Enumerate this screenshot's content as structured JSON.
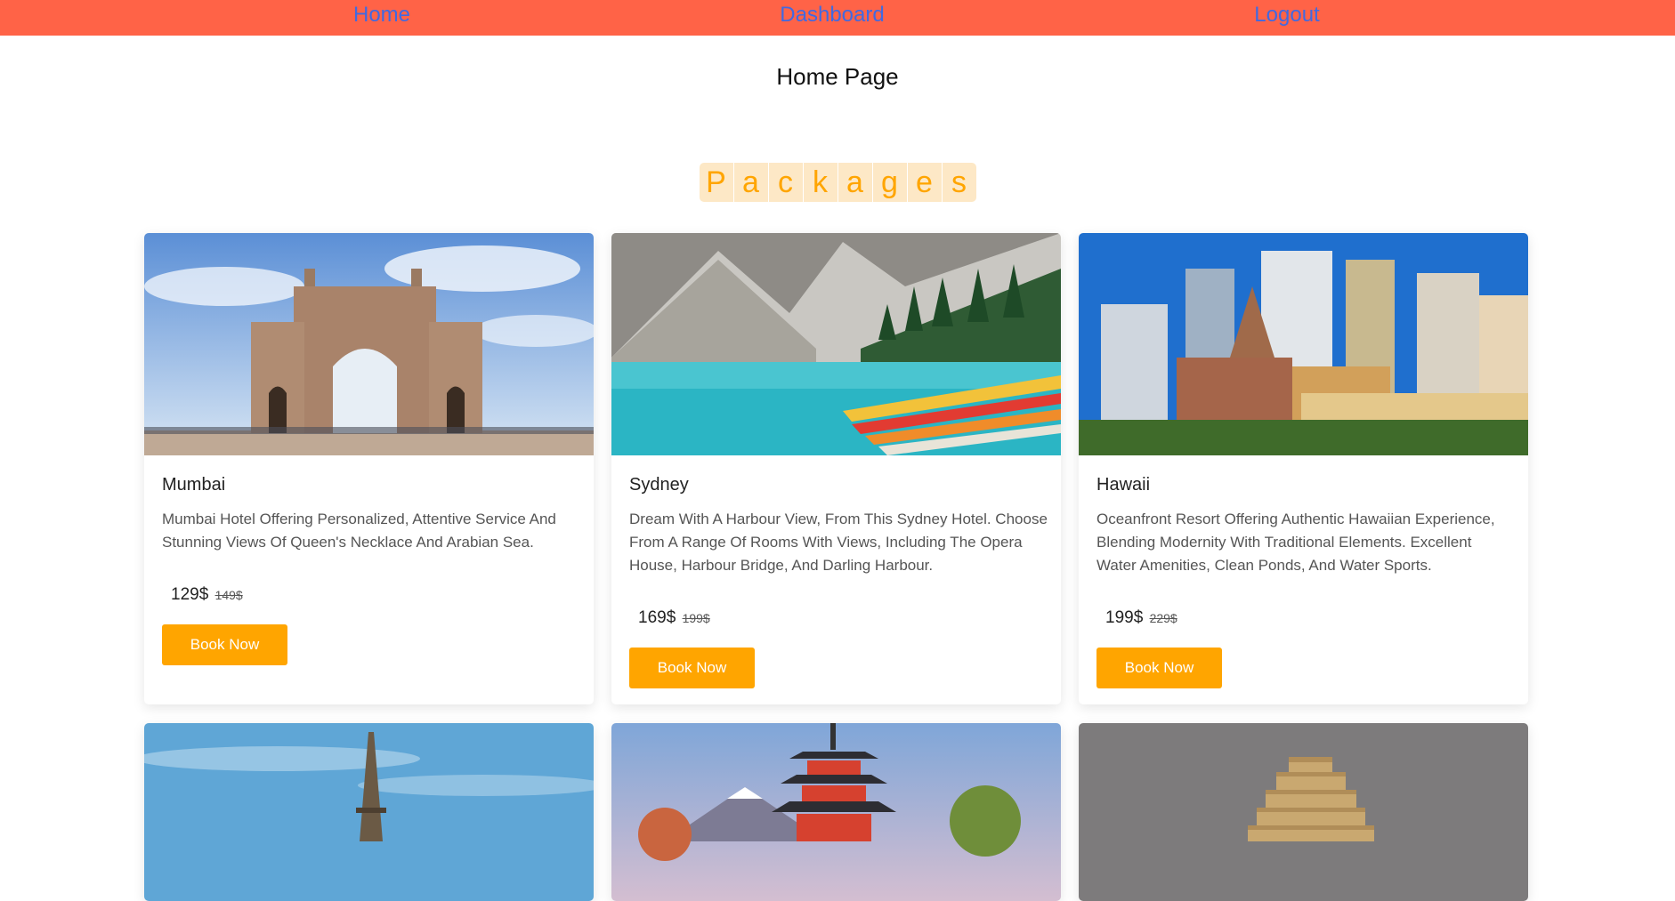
{
  "nav": {
    "home": "Home",
    "dashboard": "Dashboard",
    "logout": "Logout"
  },
  "page_title": "Home Page",
  "packages_title": [
    "P",
    "a",
    "c",
    "k",
    "a",
    "g",
    "e",
    "s"
  ],
  "colors": {
    "nav_bg": "#ff6347",
    "nav_link": "#4169e1",
    "accent": "#ffa500",
    "packages_bg": "#fde8c6"
  },
  "packages": [
    {
      "name": "Mumbai",
      "image_icon": "gateway-of-india-image",
      "description": "Mumbai Hotel Offering Personalized, Attentive Service And Stunning Views Of Queen's Necklace And Arabian Sea.",
      "price": "129$",
      "old_price": "149$",
      "button": "Book Now"
    },
    {
      "name": "Sydney",
      "image_icon": "mountain-lake-image",
      "description": "Dream With A Harbour View, From This Sydney Hotel. Choose From A Range Of Rooms With Views, Including The Opera House, Harbour Bridge, And Darling Harbour.",
      "price": "169$",
      "old_price": "199$",
      "button": "Book Now"
    },
    {
      "name": "Hawaii",
      "image_icon": "city-skyline-image",
      "description": "Oceanfront Resort Offering Authentic Hawaiian Experience, Blending Modernity With Traditional Elements. Excellent Water Amenities, Clean Ponds, And Water Sports.",
      "price": "199$",
      "old_price": "229$",
      "button": "Book Now"
    },
    {
      "image_icon": "eiffel-tower-image"
    },
    {
      "image_icon": "pagoda-fuji-image"
    },
    {
      "image_icon": "step-pyramid-image"
    }
  ]
}
